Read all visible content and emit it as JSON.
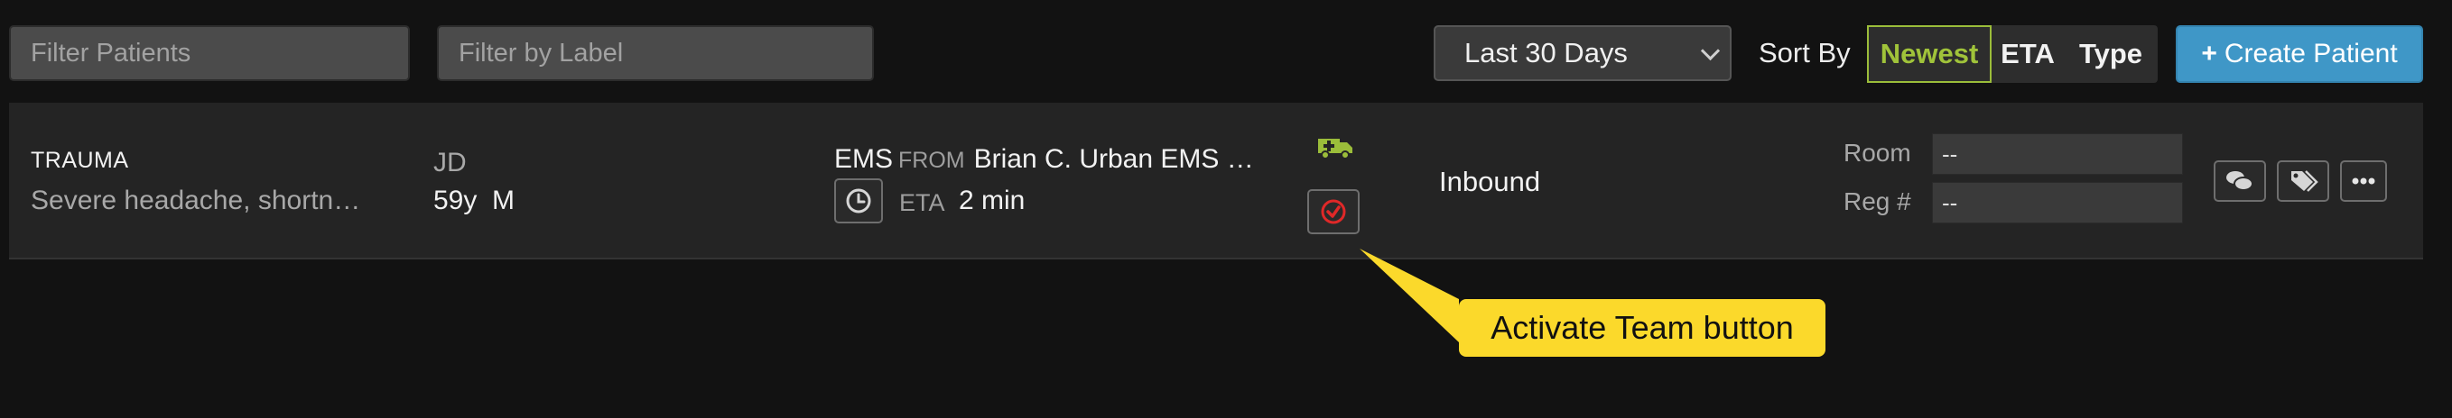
{
  "toolbar": {
    "filter_patients_placeholder": "Filter Patients",
    "filter_label_placeholder": "Filter by Label",
    "date_range": "Last 30 Days",
    "sort_by_label": "Sort By",
    "sort_options": [
      "Newest",
      "ETA",
      "Type"
    ],
    "sort_active": "Newest",
    "create_button": "Create Patient",
    "create_icon": "plus-icon",
    "accent_color": "#9bbd3a",
    "primary_color": "#3f97c7"
  },
  "patient": {
    "type": "TRAUMA",
    "complaint": "Severe headache, shortn…",
    "initials": "JD",
    "age_sex": "59y  M",
    "source": "EMS",
    "from_label": "FROM",
    "origin": "Brian C. Urban EMS …",
    "eta_label": "ETA",
    "eta_value": "2 min",
    "status": "Inbound",
    "room_label": "Room",
    "room_value": "--",
    "reg_label": "Reg #",
    "reg_value": "--",
    "icons": [
      "clock-icon",
      "ambulance-icon",
      "check-circle-icon",
      "comment-icon",
      "tags-icon",
      "ellipsis-icon"
    ]
  },
  "callout": {
    "text": "Activate Team button",
    "color": "#fbd92b"
  }
}
